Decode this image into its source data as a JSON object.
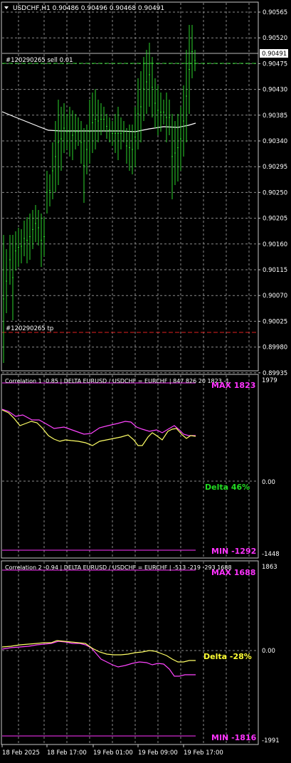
{
  "main": {
    "title": "USDCHF,H1  0.90486 0.90496 0.90468 0.90491",
    "current_price": "0.90491",
    "price_levels": [
      "0.90565",
      "0.90520",
      "0.90475",
      "0.90430",
      "0.90385",
      "0.90340",
      "0.90295",
      "0.90250",
      "0.90205",
      "0.90160",
      "0.90115",
      "0.90070",
      "0.90025",
      "0.89980",
      "0.89935"
    ],
    "order_sell_label": "#120290265 sell 0.01",
    "order_tp_label": "#120290265 tp",
    "colors": {
      "candle": "#2bd42b",
      "sell_line": "#2bd42b",
      "tp_line": "#e02020",
      "ma_line": "#ffffff",
      "grid": "#8a8a8a"
    }
  },
  "panel1": {
    "header": "Correlation 1 -0.85  |  DELTA EURUSD / USDCHF = EURCHF  |   847 826 20 1823 -1",
    "max_label": "MAX 1823",
    "min_label": "MIN -1292",
    "delta_label": "Delta 46%",
    "scale_top": "1979",
    "scale_mid": "0.00",
    "scale_bottom": "-1448",
    "colors": {
      "line_a": "#ff44ff",
      "line_b": "#ffff66",
      "delta": "#22dd22",
      "label": "#ff33ff"
    }
  },
  "panel2": {
    "header": "Correlation 2 -0.94  |  DELTA EURUSD / USDCHF = EURCHF  |   -513 -219 -293 1688",
    "max_label": "MAX 1688",
    "min_label": "MIN -1816",
    "delta_label": "Delta -28%",
    "scale_top": "1863",
    "scale_mid": "0.00",
    "scale_bottom": "-1991",
    "colors": {
      "line_a": "#ff44ff",
      "line_b": "#ffff66",
      "delta": "#ffff33",
      "label": "#ff33ff"
    }
  },
  "time_axis": [
    "18 Feb 2025",
    "18 Feb 17:00",
    "19 Feb 01:00",
    "19 Feb 09:00",
    "19 Feb 17:00"
  ]
}
